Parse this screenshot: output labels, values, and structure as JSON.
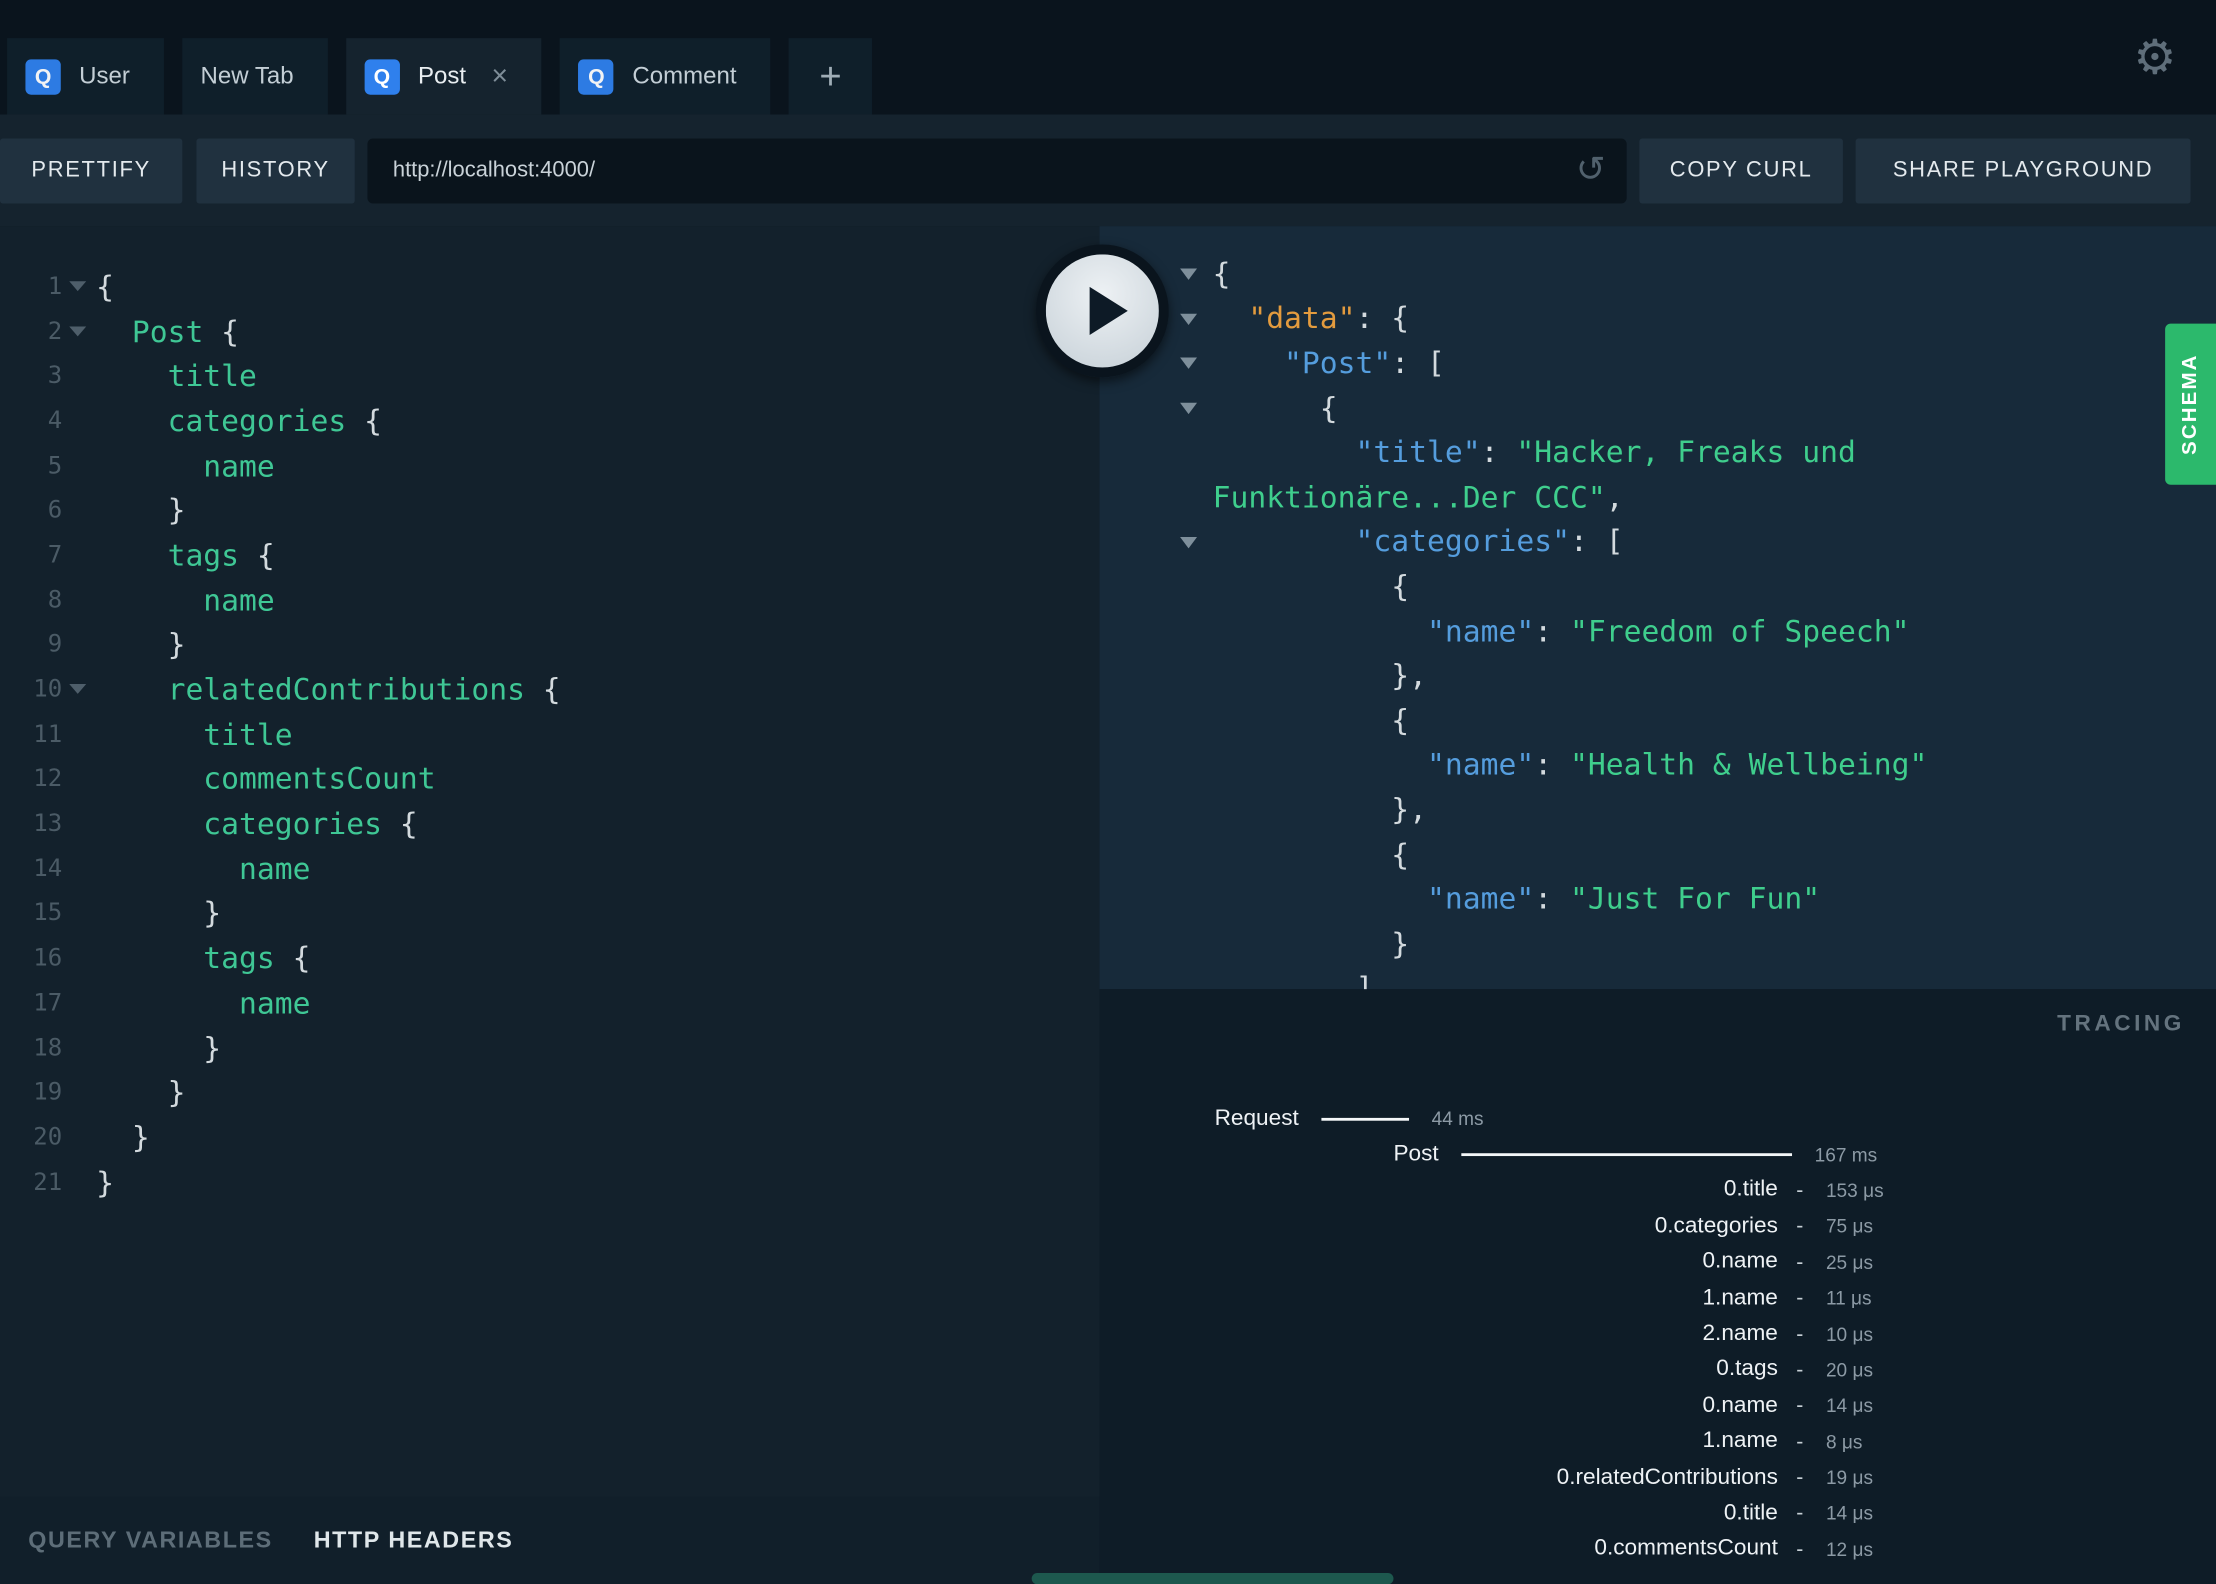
{
  "colors": {
    "schema-green": "#2cb96c",
    "query-icon-blue": "#2f80ed",
    "syntax-field": "#3fc795",
    "syntax-string": "#3fce8d",
    "syntax-key-blue": "#559ddd",
    "syntax-key-orange": "#e39b3e",
    "bar-white": "#f4f7f9",
    "scrollbar-teal": "#1d584e"
  },
  "tabs": {
    "query_icon_glyph": "Q",
    "close_glyph": "×",
    "new_tab_glyph": "+",
    "settings_glyph": "⚙",
    "items": [
      {
        "label": "User",
        "has_query_icon": true,
        "active": false,
        "closable": false
      },
      {
        "label": "New Tab",
        "has_query_icon": false,
        "active": false,
        "closable": false
      },
      {
        "label": "Post",
        "has_query_icon": true,
        "active": true,
        "closable": true
      },
      {
        "label": "Comment",
        "has_query_icon": true,
        "active": false,
        "closable": false
      }
    ]
  },
  "toolbar": {
    "prettify_label": "PRETTIFY",
    "history_label": "HISTORY",
    "url_value": "http://localhost:4000/",
    "reload_glyph": "↺",
    "copy_curl_label": "COPY CURL",
    "share_label": "SHARE PLAYGROUND"
  },
  "editor": {
    "lines": [
      {
        "num": 1,
        "fold": true,
        "tokens": [
          [
            "p",
            "{"
          ]
        ]
      },
      {
        "num": 2,
        "fold": true,
        "tokens": [
          [
            "f",
            "  Post"
          ],
          [
            "p",
            " {"
          ]
        ]
      },
      {
        "num": 3,
        "tokens": [
          [
            "f",
            "    title"
          ]
        ]
      },
      {
        "num": 4,
        "tokens": [
          [
            "f",
            "    categories"
          ],
          [
            "p",
            " {"
          ]
        ]
      },
      {
        "num": 5,
        "tokens": [
          [
            "f",
            "      name"
          ]
        ]
      },
      {
        "num": 6,
        "tokens": [
          [
            "p",
            "    }"
          ]
        ]
      },
      {
        "num": 7,
        "tokens": [
          [
            "f",
            "    tags"
          ],
          [
            "p",
            " {"
          ]
        ]
      },
      {
        "num": 8,
        "tokens": [
          [
            "f",
            "      name"
          ]
        ]
      },
      {
        "num": 9,
        "tokens": [
          [
            "p",
            "    }"
          ]
        ]
      },
      {
        "num": 10,
        "fold": true,
        "tokens": [
          [
            "f",
            "    relatedContributions"
          ],
          [
            "p",
            " {"
          ]
        ]
      },
      {
        "num": 11,
        "tokens": [
          [
            "f",
            "      title"
          ]
        ]
      },
      {
        "num": 12,
        "tokens": [
          [
            "f",
            "      commentsCount"
          ]
        ]
      },
      {
        "num": 13,
        "tokens": [
          [
            "f",
            "      categories"
          ],
          [
            "p",
            " {"
          ]
        ]
      },
      {
        "num": 14,
        "tokens": [
          [
            "f",
            "        name"
          ]
        ]
      },
      {
        "num": 15,
        "tokens": [
          [
            "p",
            "      }"
          ]
        ]
      },
      {
        "num": 16,
        "tokens": [
          [
            "f",
            "      tags"
          ],
          [
            "p",
            " {"
          ]
        ]
      },
      {
        "num": 17,
        "tokens": [
          [
            "f",
            "        name"
          ]
        ]
      },
      {
        "num": 18,
        "tokens": [
          [
            "p",
            "      }"
          ]
        ]
      },
      {
        "num": 19,
        "tokens": [
          [
            "p",
            "    }"
          ]
        ]
      },
      {
        "num": 20,
        "tokens": [
          [
            "p",
            "  }"
          ]
        ]
      },
      {
        "num": 21,
        "tokens": [
          [
            "p",
            "}"
          ]
        ]
      }
    ]
  },
  "response": {
    "lines": [
      {
        "fold": true,
        "tokens": [
          [
            "p",
            "{"
          ]
        ]
      },
      {
        "fold": true,
        "tokens": [
          [
            "ko",
            "  \"data\""
          ],
          [
            "p",
            ": {"
          ]
        ]
      },
      {
        "fold": true,
        "tokens": [
          [
            "kb",
            "    \"Post\""
          ],
          [
            "p",
            ": ["
          ]
        ]
      },
      {
        "fold": true,
        "tokens": [
          [
            "p",
            "      {"
          ]
        ]
      },
      {
        "tokens": [
          [
            "kb",
            "        \"title\""
          ],
          [
            "p",
            ": "
          ],
          [
            "s",
            "\"Hacker, Freaks und"
          ]
        ]
      },
      {
        "tokens": [
          [
            "s",
            "Funktionäre...Der CCC\""
          ],
          [
            "p",
            ","
          ]
        ]
      },
      {
        "fold": true,
        "tokens": [
          [
            "kb",
            "        \"categories\""
          ],
          [
            "p",
            ": ["
          ]
        ]
      },
      {
        "tokens": [
          [
            "p",
            "          {"
          ]
        ]
      },
      {
        "tokens": [
          [
            "kb",
            "            \"name\""
          ],
          [
            "p",
            ": "
          ],
          [
            "s",
            "\"Freedom of Speech\""
          ]
        ]
      },
      {
        "tokens": [
          [
            "p",
            "          },"
          ]
        ]
      },
      {
        "tokens": [
          [
            "p",
            "          {"
          ]
        ]
      },
      {
        "tokens": [
          [
            "kb",
            "            \"name\""
          ],
          [
            "p",
            ": "
          ],
          [
            "s",
            "\"Health & Wellbeing\""
          ]
        ]
      },
      {
        "tokens": [
          [
            "p",
            "          },"
          ]
        ]
      },
      {
        "tokens": [
          [
            "p",
            "          {"
          ]
        ]
      },
      {
        "tokens": [
          [
            "kb",
            "            \"name\""
          ],
          [
            "p",
            ": "
          ],
          [
            "s",
            "\"Just For Fun\""
          ]
        ]
      },
      {
        "tokens": [
          [
            "p",
            "          }"
          ]
        ]
      },
      {
        "tokens": [
          [
            "p",
            "        ]"
          ]
        ]
      }
    ]
  },
  "schema_tab": {
    "label": "SCHEMA"
  },
  "tracing": {
    "title": "TRACING",
    "dash_glyph": "-",
    "rows": [
      {
        "kind": "request",
        "label": "Request",
        "value": "44 ms",
        "bar_length": 62
      },
      {
        "kind": "operation",
        "label": "Post",
        "value": "167 ms",
        "bar_length": 234
      },
      {
        "kind": "resolver",
        "label": "0.title",
        "value": "153 μs"
      },
      {
        "kind": "resolver",
        "label": "0.categories",
        "value": "75 μs"
      },
      {
        "kind": "resolver",
        "label": "0.name",
        "value": "25 μs"
      },
      {
        "kind": "resolver",
        "label": "1.name",
        "value": "11 μs"
      },
      {
        "kind": "resolver",
        "label": "2.name",
        "value": "10 μs"
      },
      {
        "kind": "resolver",
        "label": "0.tags",
        "value": "20 μs"
      },
      {
        "kind": "resolver",
        "label": "0.name",
        "value": "14 μs"
      },
      {
        "kind": "resolver",
        "label": "1.name",
        "value": "8 μs"
      },
      {
        "kind": "resolver",
        "label": "0.relatedContributions",
        "value": "19 μs"
      },
      {
        "kind": "resolver",
        "label": "0.title",
        "value": "14 μs"
      },
      {
        "kind": "resolver",
        "label": "0.commentsCount",
        "value": "12 μs"
      }
    ]
  },
  "footer": {
    "query_variables_label": "QUERY VARIABLES",
    "http_headers_label": "HTTP HEADERS"
  }
}
